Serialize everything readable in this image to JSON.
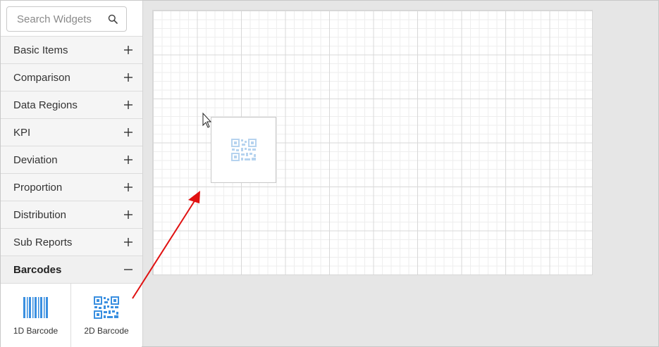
{
  "search": {
    "placeholder": "Search Widgets"
  },
  "categories": [
    {
      "label": "Basic Items",
      "state": "collapsed"
    },
    {
      "label": "Comparison",
      "state": "collapsed"
    },
    {
      "label": "Data Regions",
      "state": "collapsed"
    },
    {
      "label": "KPI",
      "state": "collapsed"
    },
    {
      "label": "Deviation",
      "state": "collapsed"
    },
    {
      "label": "Proportion",
      "state": "collapsed"
    },
    {
      "label": "Distribution",
      "state": "collapsed"
    },
    {
      "label": "Sub Reports",
      "state": "collapsed"
    },
    {
      "label": "Barcodes",
      "state": "expanded"
    }
  ],
  "widgets": [
    {
      "label": "1D Barcode",
      "icon": "barcode-1d-icon"
    },
    {
      "label": "2D Barcode",
      "icon": "qr-code-icon"
    }
  ],
  "colors": {
    "accent": "#3a8fe0",
    "arrow": "#e01010",
    "preview_icon": "#b6d3ef"
  }
}
